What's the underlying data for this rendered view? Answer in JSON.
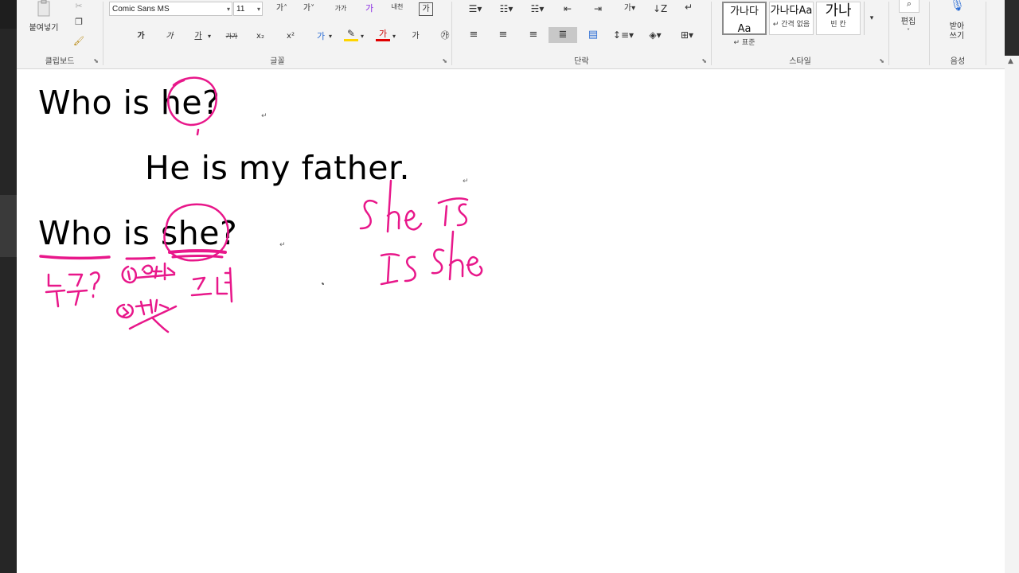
{
  "ribbon": {
    "clipboard": {
      "paste_label": "붙여넣기",
      "group_label": "클립보드"
    },
    "font": {
      "family": "Comic Sans MS",
      "size": "11",
      "group_label": "글꼴",
      "grow": "가˄",
      "shrink": "가˅",
      "case": "가가",
      "clear": "가",
      "phonetic": "내천",
      "charborder": "가",
      "bold": "가",
      "italic": "가",
      "underline": "가",
      "strike": "가가",
      "subscript": "x₂",
      "superscript": "x²",
      "effects": "가",
      "highlight": "✎",
      "fontcolor": "가",
      "charshade": "가",
      "enclose": "㉮"
    },
    "paragraph": {
      "group_label": "단락"
    },
    "styles": {
      "group_label": "스타일",
      "items": [
        {
          "preview": "가나다Aa",
          "name": "↵ 표준"
        },
        {
          "preview": "가나다Aa",
          "name": "↵ 간격 없음"
        },
        {
          "preview": "가나",
          "name": "빈 칸"
        }
      ]
    },
    "editing": {
      "label": "편집"
    },
    "voice": {
      "label": "받아\n쓰기",
      "short": "받아",
      "short2": "쓰기",
      "group_label": "음성"
    }
  },
  "document": {
    "line1": "Who is he?",
    "line2": "He is my father.",
    "line3": "Who is she?",
    "para_mark": "↵"
  },
  "colors": {
    "ink": "#e8178a",
    "ribbon_bg": "#f3f3f3"
  }
}
